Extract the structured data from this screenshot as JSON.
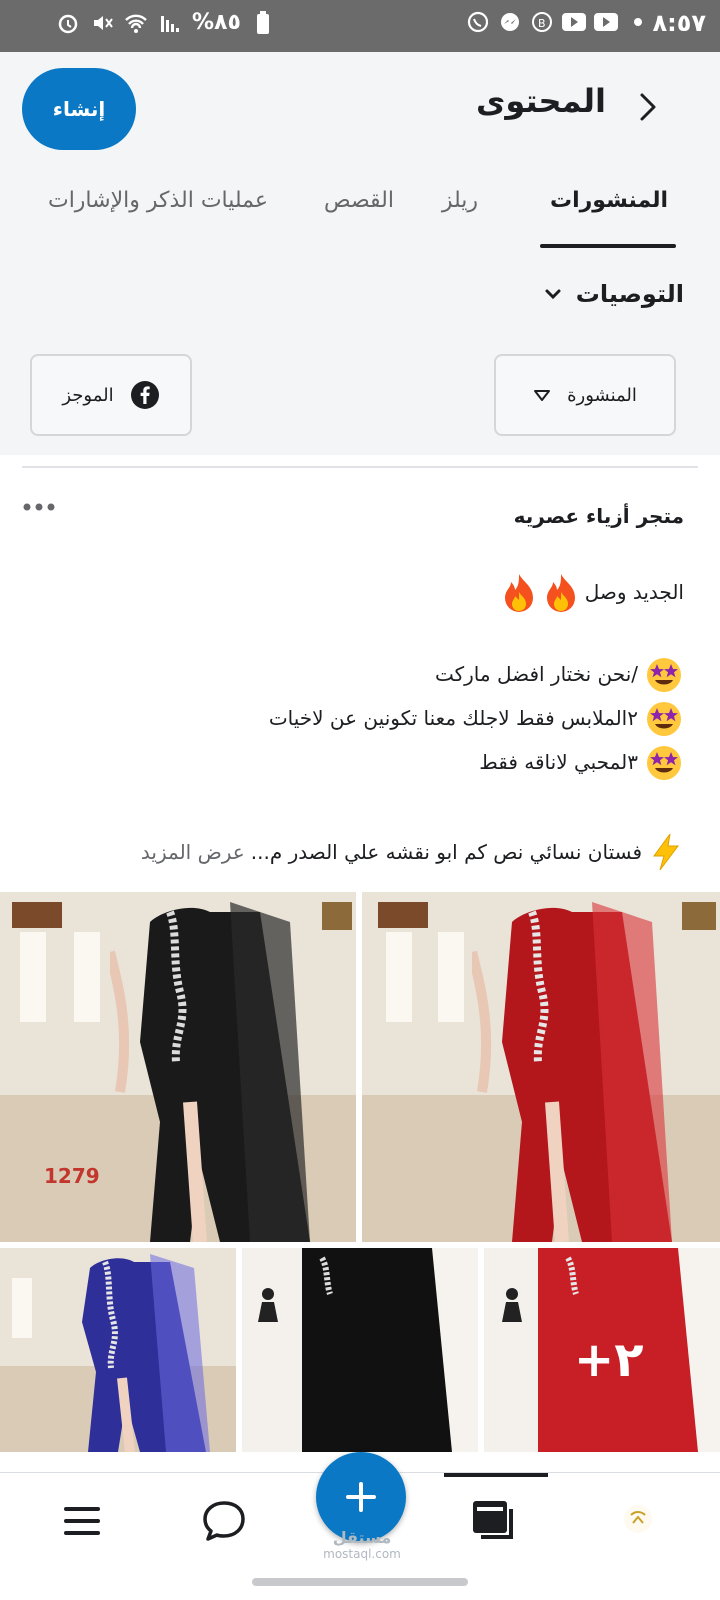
{
  "status_bar": {
    "time": "٨:٥٧",
    "battery": "%٨٥"
  },
  "header": {
    "title": "المحتوى",
    "create_label": "إنشاء"
  },
  "tabs": [
    {
      "label": "المنشورات",
      "active": true
    },
    {
      "label": "ريلز",
      "active": false
    },
    {
      "label": "القصص",
      "active": false
    },
    {
      "label": "عمليات الذكر والإشارات",
      "active": false
    }
  ],
  "recommendations_label": "التوصيات",
  "filters": {
    "published_label": "المنشورة",
    "summary_label": "الموجز"
  },
  "post": {
    "author": "متجر أزياء عصريه",
    "line1": "الجديد وصل",
    "bullet1": "/نحن نختار افضل ماركت",
    "bullet2": "٢الملابس فقط لاجلك معنا تكونين عن لاخيات",
    "bullet3": "٣لمحبي لاناقه فقط",
    "description": "فستان نسائي نص كم ابو نقشه علي الصدر م...",
    "see_more": "عرض المزيد",
    "photo_code": "1279",
    "more_photos": "+٢"
  },
  "bottom_nav": {
    "items": [
      "menu-icon",
      "chat-icon",
      "create-icon",
      "posts-icon",
      "profile-icon"
    ]
  },
  "watermark": {
    "line1": "مستقل",
    "line2": "mostaql.com"
  },
  "colors": {
    "accent": "#0a78c4",
    "text": "#1c1e21",
    "muted": "#65676b"
  }
}
